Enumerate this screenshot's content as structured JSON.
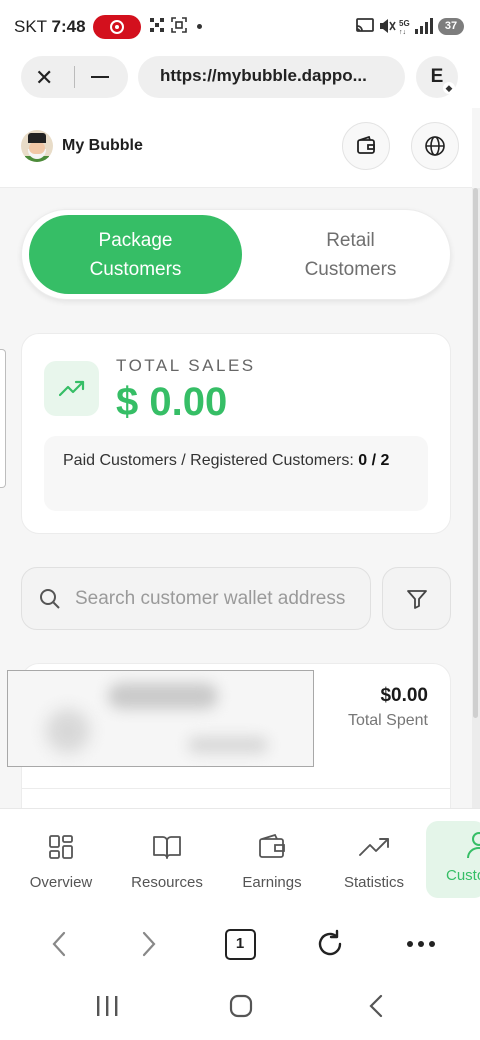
{
  "status_bar": {
    "carrier": "SKT",
    "time": "7:48",
    "battery": "37"
  },
  "browser": {
    "url": "https://mybubble.dappo...",
    "extension_letter": "E",
    "extension_badge": "◆",
    "tab_count": "1"
  },
  "app": {
    "name": "My Bubble"
  },
  "segments": {
    "package": "Package\nCustomers",
    "retail": "Retail\nCustomers"
  },
  "stats": {
    "total_sales_label": "TOTAL SALES",
    "total_sales_value": "$ 0.00",
    "paid_label": "Paid Customers / Registered Customers:",
    "paid_value": "0 / 2"
  },
  "search": {
    "placeholder": "Search customer wallet address"
  },
  "customers": [
    {
      "amount": "$0.00",
      "amount_label": "Total Spent"
    }
  ],
  "nav": {
    "items": [
      {
        "label": "Overview",
        "icon": "grid-icon"
      },
      {
        "label": "Resources",
        "icon": "book-icon"
      },
      {
        "label": "Earnings",
        "icon": "wallet-icon"
      },
      {
        "label": "Statistics",
        "icon": "trend-icon"
      },
      {
        "label": "Customers",
        "icon": "user-icon"
      }
    ]
  },
  "colors": {
    "accent": "#36be66",
    "accent_light": "#e4f5e9",
    "record": "#d3101d"
  }
}
